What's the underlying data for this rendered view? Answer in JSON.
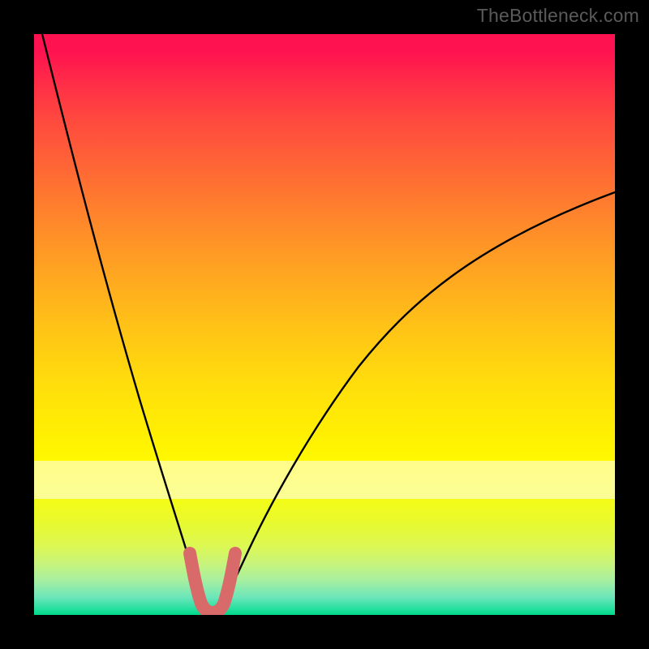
{
  "watermark": "TheBottleneck.com",
  "colors": {
    "background": "#000000",
    "curve": "#000000",
    "marker_stroke": "#d96a6a",
    "watermark": "#5a5a5a"
  },
  "chart_data": {
    "type": "line",
    "title": "",
    "xlabel": "",
    "ylabel": "",
    "xlim": [
      0,
      100
    ],
    "ylim": [
      0,
      100
    ],
    "grid": false,
    "legend": false,
    "series": [
      {
        "name": "bottleneck-curve",
        "x": [
          0,
          2,
          4,
          6,
          8,
          10,
          12,
          14,
          16,
          18,
          20,
          22,
          24,
          26,
          27,
          28,
          29,
          30,
          31,
          32,
          34,
          36,
          38,
          40,
          44,
          48,
          52,
          56,
          60,
          64,
          68,
          72,
          76,
          80,
          84,
          88,
          92,
          96,
          100
        ],
        "y": [
          100,
          92,
          84,
          76,
          68,
          60,
          52,
          45,
          38,
          31,
          25,
          19,
          13,
          8,
          6,
          4,
          2,
          0.7,
          0.5,
          1.5,
          5,
          10,
          15,
          20,
          28,
          34,
          40,
          45,
          50,
          54,
          58,
          61,
          64,
          67,
          69,
          71.5,
          73.5,
          75,
          77
        ]
      },
      {
        "name": "marker-band",
        "x": [
          26.5,
          27,
          27.5,
          28,
          28.5,
          29,
          29.5,
          30,
          30.5,
          31,
          31.5,
          32,
          32.5,
          33
        ],
        "y": [
          11,
          8.5,
          6,
          4,
          2.5,
          1.5,
          1,
          1,
          1.5,
          2.5,
          4,
          6,
          8.5,
          11
        ]
      }
    ],
    "annotations": [
      {
        "text": "TheBottleneck.com",
        "position": "top-right"
      }
    ],
    "background_gradient": {
      "orientation": "vertical",
      "stops": [
        {
          "pos": 0.0,
          "color": "#ff1250"
        },
        {
          "pos": 0.33,
          "color": "#ff8a2a"
        },
        {
          "pos": 0.69,
          "color": "#fff002"
        },
        {
          "pos": 1.0,
          "color": "#00d989"
        }
      ]
    },
    "highlight_band_y": [
      73,
      80
    ]
  }
}
